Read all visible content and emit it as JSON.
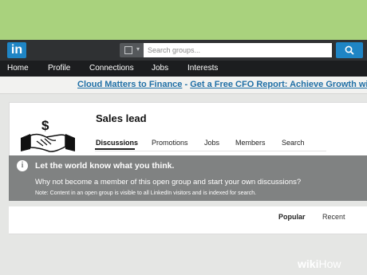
{
  "search": {
    "placeholder": "Search groups..."
  },
  "logo": {
    "text": "in"
  },
  "nav": {
    "items": [
      "Home",
      "Profile",
      "Connections",
      "Jobs",
      "Interests"
    ]
  },
  "ad": {
    "link_text": "Cloud Matters to Finance",
    "separator": " - ",
    "rest_text": "Get a Free CFO Report: Achieve Growth with Clo"
  },
  "group": {
    "name": "Sales lead",
    "tabs": [
      "Discussions",
      "Promotions",
      "Jobs",
      "Members",
      "Search"
    ],
    "active_tab": "Discussions"
  },
  "notice": {
    "icon": "i",
    "heading": "Let the world know what you think.",
    "message": "Why not become a member of this open group and start your own discussions?",
    "note": "Note: Content in an open group is visible to all LinkedIn visitors and is indexed for search."
  },
  "sort": {
    "popular": "Popular",
    "recent": "Recent"
  },
  "watermark": {
    "wiki": "wiki",
    "how": "How"
  },
  "colors": {
    "accent": "#1f85c5",
    "nav_bg": "#1c1d1f",
    "topbar_bg": "#2f3133",
    "notice_bg": "#808282",
    "ad_link": "#1f6fa6",
    "frame_green": "#a9d27d"
  }
}
